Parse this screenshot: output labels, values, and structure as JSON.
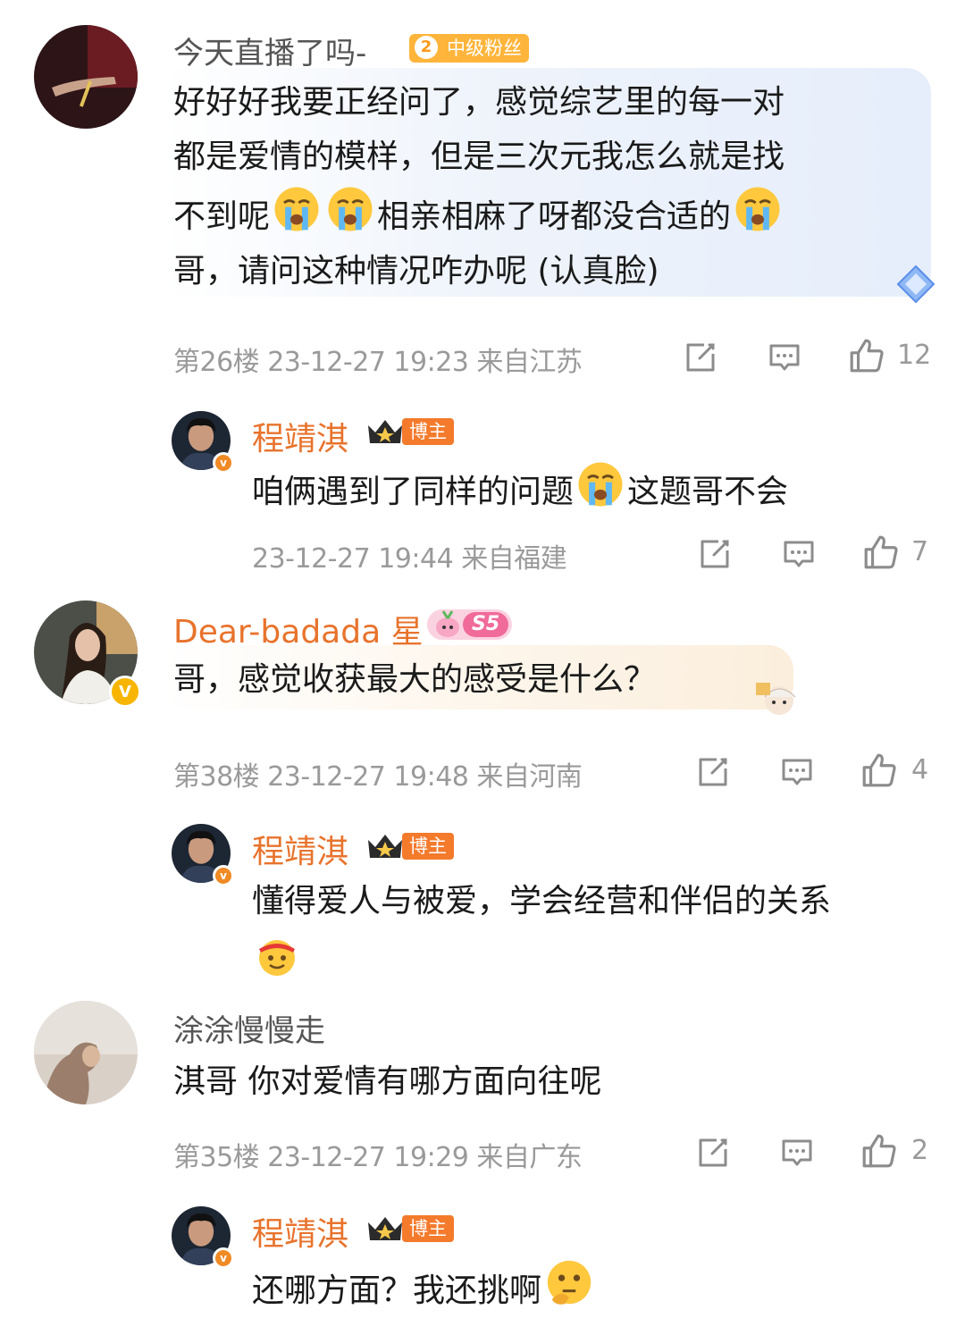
{
  "colors": {
    "orange_name": "#e8732c",
    "meta_gray": "#9a9a9a",
    "bubble_blue": "#eef3fb",
    "bubble_beige": "#fdf6ec",
    "host_badge": "#f47a2c",
    "fan_badge": "#ffb53b"
  },
  "comments": [
    {
      "user": {
        "name": "今天直播了吗-",
        "badge_level": "2",
        "badge_label": "中级粉丝"
      },
      "text": "好好好我要正经问了，感觉综艺里的每一对都是爱情的模样，但是三次元我怎么就是找不到呢",
      "text_lines": [
        "好好好我要正经问了，感觉综艺里的每一对",
        "都是爱情的模样，但是三次元我怎么就是找",
        "不到呢",
        "相亲相麻了呀都没合适的",
        "哥，请问这种情况咋办呢 (认真脸)"
      ],
      "emojis": [
        "crying-emoji",
        "crying-emoji",
        "crying-emoji"
      ],
      "meta": "第26楼 23-12-27 19:23 来自江苏",
      "likes": "12",
      "reply": {
        "user": {
          "name": "程靖淇",
          "badge_label": "博主"
        },
        "text_a": "咱俩遇到了同样的问题",
        "text_b": "这题哥不会",
        "meta": "23-12-27 19:44 来自福建",
        "likes": "7"
      }
    },
    {
      "user": {
        "name": "Dear-badada",
        "name_suffix": "星",
        "badge_label": "S5"
      },
      "text": "哥，感觉收获最大的感受是什么？",
      "meta": "第38楼 23-12-27 19:48 来自河南",
      "likes": "4",
      "reply": {
        "user": {
          "name": "程靖淇",
          "badge_label": "博主"
        },
        "text": "懂得爱人与被爱，学会经营和伴侣的关系",
        "meta": "",
        "likes": ""
      }
    },
    {
      "user": {
        "name": "涂涂慢慢走"
      },
      "text": "淇哥 你对爱情有哪方面向往呢",
      "meta": "第35楼 23-12-27 19:29 来自广东",
      "likes": "2",
      "reply": {
        "user": {
          "name": "程靖淇",
          "badge_label": "博主"
        },
        "text": "还哪方面？我还挑啊",
        "meta": "",
        "likes": ""
      }
    }
  ]
}
